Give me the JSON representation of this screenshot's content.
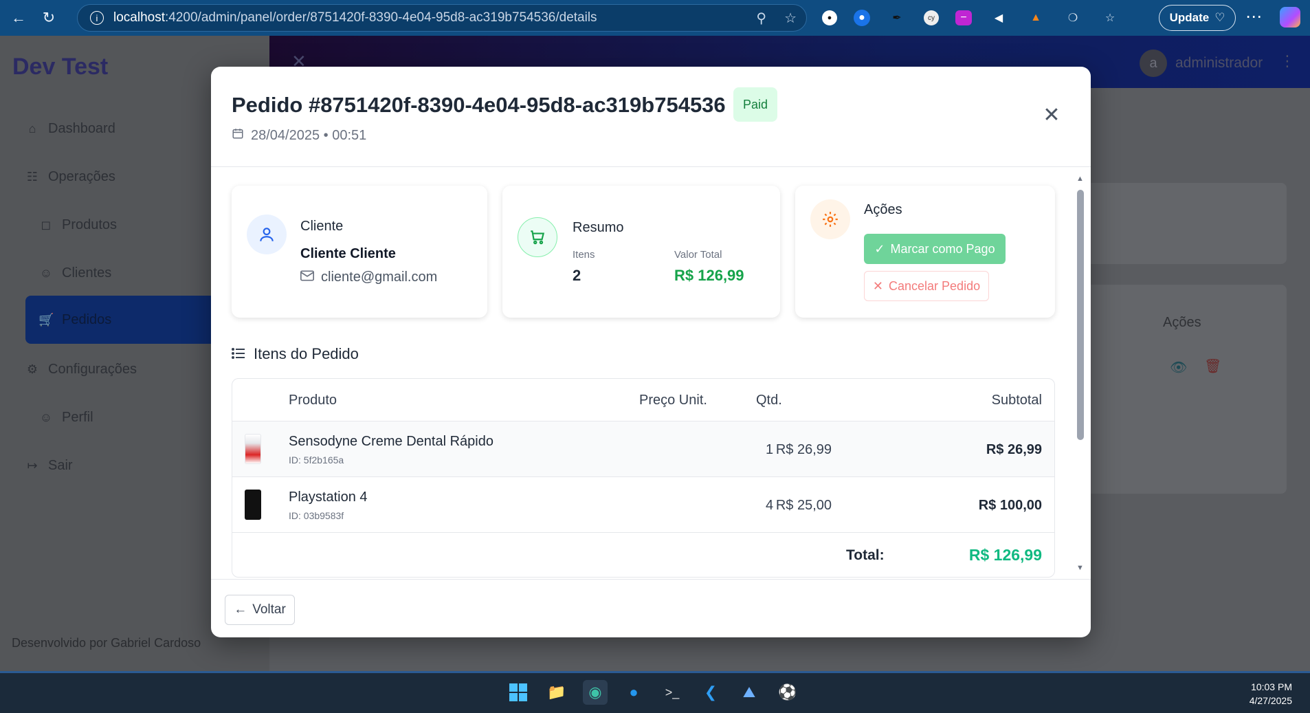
{
  "browser": {
    "url_host": "localhost",
    "url_path": ":4200/admin/panel/order/8751420f-8390-4e04-95d8-ac319b754536/details",
    "update_label": "Update"
  },
  "app": {
    "brand": "Dev Test",
    "nav": [
      {
        "label": "Dashboard",
        "icon": "home-icon"
      },
      {
        "label": "Operações",
        "icon": "database-icon"
      },
      {
        "label": "Produtos",
        "icon": "box-icon"
      },
      {
        "label": "Clientes",
        "icon": "user-icon"
      },
      {
        "label": "Pedidos",
        "icon": "cart-icon"
      },
      {
        "label": "Configurações",
        "icon": "gear-icon"
      },
      {
        "label": "Perfil",
        "icon": "user-icon"
      },
      {
        "label": "Sair",
        "icon": "logout-icon"
      }
    ],
    "footer_credit": "Desenvolvido por Gabriel Cardoso",
    "user_initial": "a",
    "user_name": "administrador",
    "bg_actions_header": "Ações"
  },
  "modal": {
    "title": "Pedido #8751420f-8390-4e04-95d8-ac319b754536",
    "status": "Paid",
    "date": "28/04/2025 • 00:51",
    "client": {
      "label": "Cliente",
      "name": "Cliente Cliente",
      "email": "cliente@gmail.com"
    },
    "summary": {
      "label": "Resumo",
      "items_label": "Itens",
      "items_value": "2",
      "total_label": "Valor Total",
      "total_value": "R$ 126,99"
    },
    "actions": {
      "label": "Ações",
      "mark_paid": "Marcar como Pago",
      "cancel": "Cancelar Pedido"
    },
    "items_section_title": "Itens do Pedido",
    "table": {
      "headers": [
        "Produto",
        "Preço Unit.",
        "Qtd.",
        "Subtotal"
      ],
      "rows": [
        {
          "name": "Sensodyne Creme Dental Rápido",
          "id": "ID: 5f2b165a",
          "price": "R$ 26,99",
          "qty": "1",
          "subtotal": "R$ 26,99"
        },
        {
          "name": "Playstation 4",
          "id": "ID: 03b9583f",
          "price": "R$ 25,00",
          "qty": "4",
          "subtotal": "R$ 100,00"
        }
      ],
      "total_label": "Total:",
      "total_value": "R$ 126,99"
    },
    "back_label": "Voltar"
  },
  "taskbar": {
    "time": "10:03 PM",
    "date": "4/27/2025"
  },
  "colors": {
    "accent_green": "#16a34a",
    "paid_badge_bg": "#dcfce7",
    "cancel_red": "#f37b7b",
    "nav_active": "#0d2a6a"
  }
}
